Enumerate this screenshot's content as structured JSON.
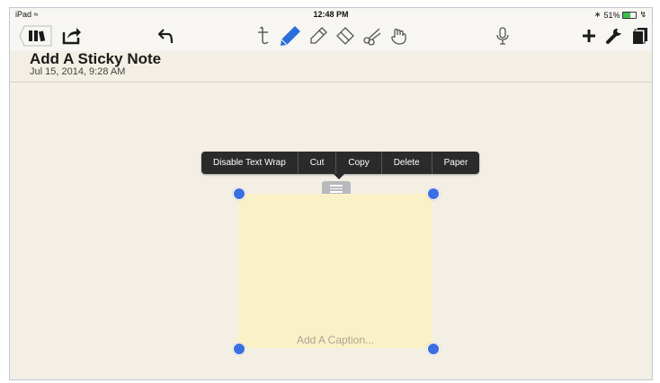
{
  "status_bar": {
    "device": "iPad",
    "time": "12:48 PM",
    "battery": "51%",
    "battery_level": 0.51
  },
  "toolbar": {
    "left_icons": [
      "library-icon",
      "share-icon",
      "undo-icon"
    ],
    "tool_icons": [
      "text-tool-icon",
      "pen-tool-icon",
      "highlighter-tool-icon",
      "eraser-tool-icon",
      "scissors-tool-icon",
      "hand-tool-icon"
    ],
    "right_icons": [
      "microphone-icon",
      "add-icon",
      "settings-wrench-icon",
      "pages-icon"
    ],
    "selected_tool": "pen-tool-icon",
    "accent_color": "#2a6fdb"
  },
  "note": {
    "title": "Add A Sticky Note",
    "date": "Jul 15, 2014, 9:28 AM"
  },
  "context_menu": {
    "items": [
      "Disable Text Wrap",
      "Cut",
      "Copy",
      "Delete",
      "Paper"
    ]
  },
  "sticky_note": {
    "caption_placeholder": "Add A Caption...",
    "color": "#fbf1c6"
  }
}
